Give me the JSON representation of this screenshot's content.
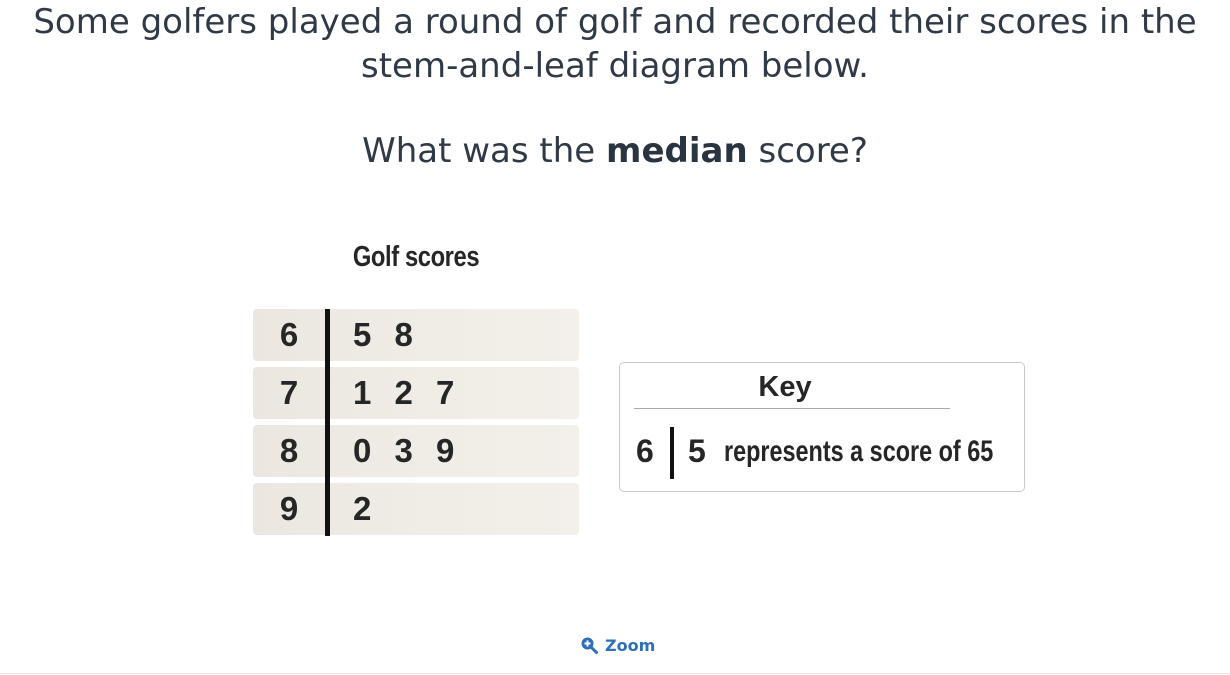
{
  "question": {
    "line1": "Some golfers played a round of golf and recorded their scores in the",
    "line2": "stem-and-leaf diagram below.",
    "prompt_before": "What was the ",
    "prompt_bold": "median",
    "prompt_after": " score?"
  },
  "diagram": {
    "title": "Golf scores",
    "rows": [
      {
        "stem": "6",
        "leaves": "5 8"
      },
      {
        "stem": "7",
        "leaves": "1 2 7"
      },
      {
        "stem": "8",
        "leaves": "0 3 9"
      },
      {
        "stem": "9",
        "leaves": "2"
      }
    ],
    "key": {
      "title": "Key",
      "stem": "6",
      "leaf": "5",
      "text": "represents a score of 65"
    }
  },
  "zoom": {
    "label": "Zoom",
    "icon": "magnify-plus-icon"
  },
  "colors": {
    "accent": "#2d6fb8",
    "row_background": "#efebe5",
    "text": "#2f3a46"
  }
}
